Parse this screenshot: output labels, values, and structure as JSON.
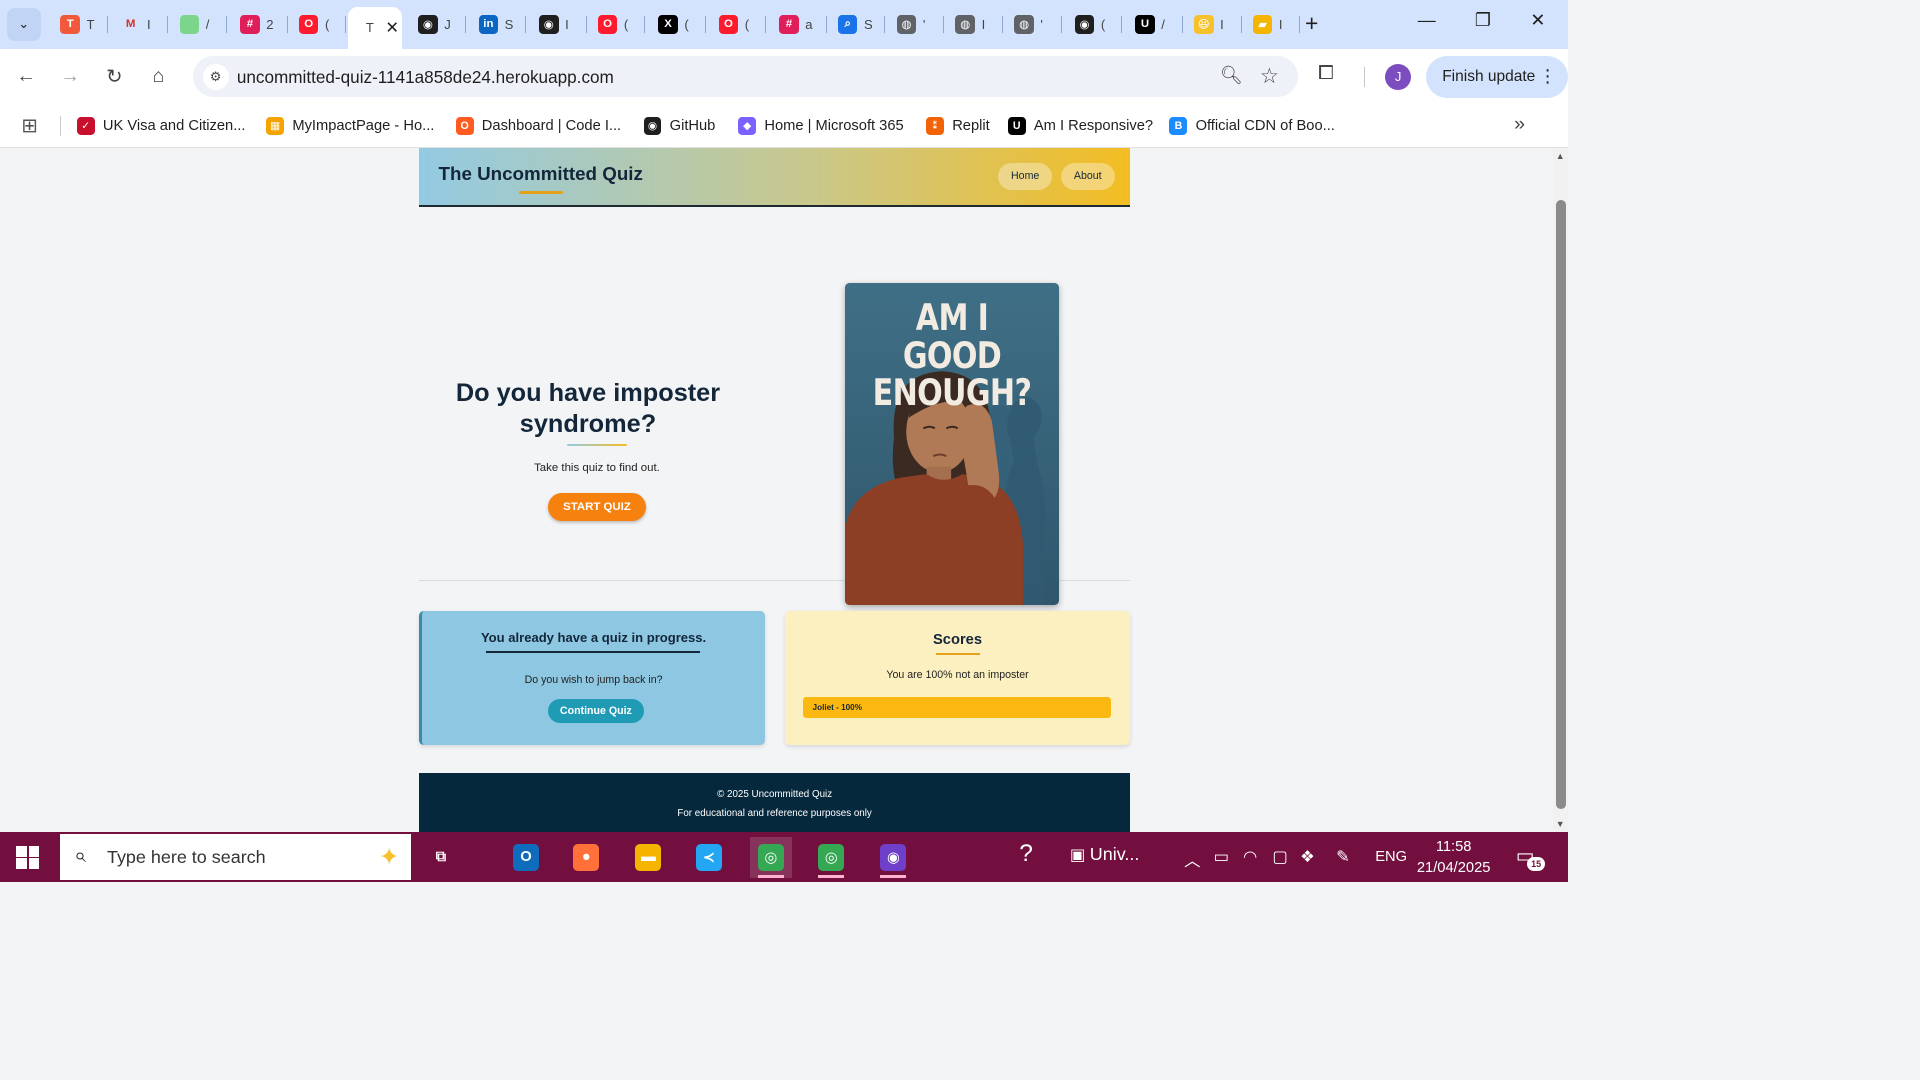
{
  "browser": {
    "tabs": [
      {
        "icon": "trello-icon",
        "title": "T",
        "color": "#f05a3b",
        "glyph": "T"
      },
      {
        "icon": "gmail-icon",
        "title": "I",
        "color": "#ffffff",
        "glyph": "M"
      },
      {
        "icon": "dot-icon",
        "title": "/",
        "color": "#7bd68b",
        "glyph": ""
      },
      {
        "icon": "slack-icon",
        "title": "2",
        "color": "#e01e5a",
        "glyph": "#"
      },
      {
        "icon": "opera-icon",
        "title": "(",
        "color": "#ff1b2d",
        "glyph": "O"
      },
      {
        "icon": "github-icon",
        "title": "J",
        "color": "#1f1f1f",
        "glyph": "◉"
      },
      {
        "icon": "linkedin-icon",
        "title": "S",
        "color": "#0a66c2",
        "glyph": "in"
      },
      {
        "icon": "github-icon",
        "title": "I",
        "color": "#1f1f1f",
        "glyph": "◉"
      },
      {
        "icon": "opera-icon",
        "title": "(",
        "color": "#ff1b2d",
        "glyph": "O"
      },
      {
        "icon": "x-icon",
        "title": "(",
        "color": "#000000",
        "glyph": "X"
      },
      {
        "icon": "opera-icon",
        "title": "(",
        "color": "#ff1b2d",
        "glyph": "O"
      },
      {
        "icon": "slack-icon",
        "title": "a",
        "color": "#e01e5a",
        "glyph": "#"
      },
      {
        "icon": "search-icon",
        "title": "S",
        "color": "#1a73e8",
        "glyph": "⌕"
      },
      {
        "icon": "globe-icon",
        "title": "'",
        "color": "#5f6368",
        "glyph": "◍"
      },
      {
        "icon": "globe-icon",
        "title": "I",
        "color": "#5f6368",
        "glyph": "◍"
      },
      {
        "icon": "globe-icon",
        "title": "'",
        "color": "#5f6368",
        "glyph": "◍"
      },
      {
        "icon": "github-icon",
        "title": "(",
        "color": "#1f1f1f",
        "glyph": "◉"
      },
      {
        "icon": "u-icon",
        "title": "/",
        "color": "#000000",
        "glyph": "U"
      },
      {
        "icon": "emoji-icon",
        "title": "I",
        "color": "#f6c12b",
        "glyph": "😆"
      },
      {
        "icon": "folder-icon",
        "title": "I",
        "color": "#f4b400",
        "glyph": "▰"
      }
    ],
    "active_tab": {
      "title": "T",
      "close_label": "✕"
    },
    "new_tab_label": "+",
    "url": "uncommitted-quiz-1141a858de24.herokuapp.com",
    "finish_update_label": "Finish update",
    "profile_initial": "J",
    "bookmarks": [
      {
        "label": "UK Visa and Citizen...",
        "icon": "uk-gov-icon",
        "color": "#c8102e",
        "glyph": "✓"
      },
      {
        "label": "MyImpactPage - Ho...",
        "icon": "grid-logo-icon",
        "color": "#f4a300",
        "glyph": "▦"
      },
      {
        "label": "Dashboard | Code I...",
        "icon": "code-institute-icon",
        "color": "#ff5a1f",
        "glyph": "O"
      },
      {
        "label": "GitHub",
        "icon": "github-icon",
        "color": "#1f1f1f",
        "glyph": "◉"
      },
      {
        "label": "Home | Microsoft 365",
        "icon": "microsoft-365-icon",
        "color": "#7b61ff",
        "glyph": "◆"
      },
      {
        "label": "Replit",
        "icon": "replit-icon",
        "color": "#f26207",
        "glyph": "⁑"
      },
      {
        "label": "Am I Responsive?",
        "icon": "u-icon",
        "color": "#000000",
        "glyph": "U"
      },
      {
        "label": "Official CDN of Boo...",
        "icon": "bootstrap-icon",
        "color": "#1a8cff",
        "glyph": "B"
      }
    ]
  },
  "site": {
    "brand": "The Uncommitted Quiz",
    "nav": [
      "Home",
      "About"
    ],
    "hero": {
      "title": "Do you have imposter syndrome?",
      "subtitle": "Take this quiz to find out.",
      "cta": "START QUIZ"
    },
    "poster": {
      "text": "AM I GOOD ENOUGH?"
    },
    "progress_card": {
      "heading": "You already have a quiz in progress.",
      "question": "Do you wish to jump back in?",
      "button": "Continue Quiz"
    },
    "scores_card": {
      "heading": "Scores",
      "summary": "You are 100% not an imposter",
      "entries": [
        {
          "label": "Joliet - 100%",
          "fraction": 1.0
        }
      ]
    },
    "footer": {
      "copyright": "© 2025 Uncommitted Quiz",
      "note": "For educational and reference purposes only"
    },
    "colors": {
      "accent_orange": "#f7810f",
      "teal_button": "#1f9bb5",
      "footer_navy": "#06283d",
      "score_fill": "#fbb810"
    }
  },
  "taskbar": {
    "search_placeholder": "Type here to search",
    "pinned": [
      {
        "name": "task-view-icon",
        "glyph": "⧉"
      },
      {
        "name": "outlook-icon",
        "glyph": "O",
        "color": "#0f6cbd"
      },
      {
        "name": "firefox-icon",
        "glyph": "●",
        "color": "#ff7139"
      },
      {
        "name": "file-explorer-icon",
        "glyph": "▬",
        "color": "#f4b400"
      },
      {
        "name": "vscode-icon",
        "glyph": "≺",
        "color": "#23a7f2"
      },
      {
        "name": "chrome-profile-icon",
        "glyph": "◎",
        "color": "#34a853"
      },
      {
        "name": "chrome-icon",
        "glyph": "◎",
        "color": "#34a853"
      },
      {
        "name": "github-desktop-icon",
        "glyph": "◉",
        "color": "#6e40c9"
      }
    ],
    "help_label": "?",
    "widget_label": "Univ...",
    "language": "ENG",
    "time": "11:58",
    "date": "21/04/2025",
    "notification_count": "15"
  }
}
